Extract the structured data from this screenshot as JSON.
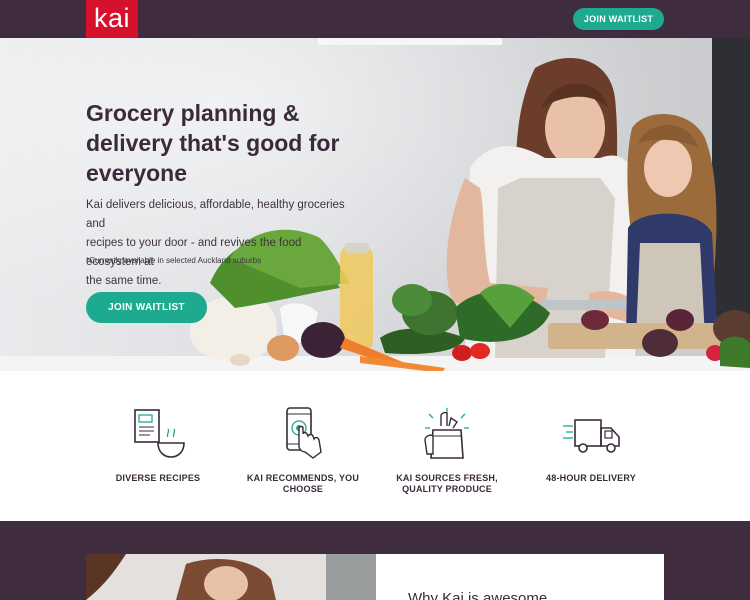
{
  "header": {
    "logo_text": "kai",
    "join_button": "JOIN WAITLIST",
    "bg_color": "#3f2c3e",
    "logo_color": "#d6112e",
    "accent_color": "#1eaa8e"
  },
  "hero": {
    "title_line1": "Grocery planning &",
    "title_line2": "delivery that's good for",
    "title_line3": "everyone",
    "body_line1": "Kai delivers delicious, affordable, healthy groceries and",
    "body_line2": "recipes to your door - and revives the food ecosystem at",
    "body_line3": "the same time.",
    "note": "*Currently available in selected Auckland suburbs",
    "join_button": "JOIN WAITLIST"
  },
  "features": [
    {
      "icon": "recipe-book-bowl-icon",
      "label_line1": "DIVERSE RECIPES",
      "label_line2": ""
    },
    {
      "icon": "phone-tap-icon",
      "label_line1": "KAI RECOMMENDS, YOU",
      "label_line2": "CHOOSE"
    },
    {
      "icon": "grocery-bag-icon",
      "label_line1": "KAI SOURCES FRESH,",
      "label_line2": "QUALITY PRODUCE"
    },
    {
      "icon": "delivery-truck-icon",
      "label_line1": "48-HOUR DELIVERY",
      "label_line2": ""
    }
  ],
  "bottom": {
    "heading": "Why Kai is awesome"
  }
}
